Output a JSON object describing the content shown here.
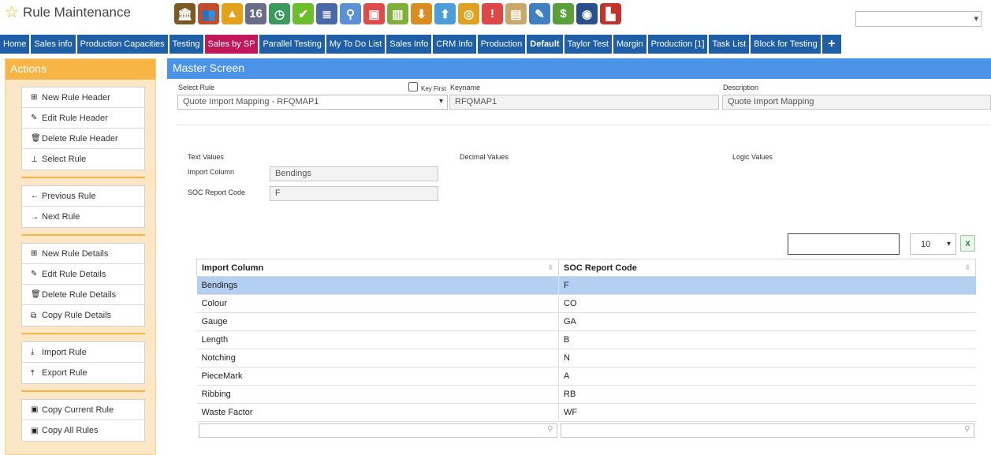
{
  "app": {
    "title": "Rule Maintenance"
  },
  "toolbar_icons": [
    {
      "name": "bank-icon",
      "glyph": "🏛",
      "color": "#7a5a1e"
    },
    {
      "name": "users-icon",
      "glyph": "👥",
      "color": "#c44b2b"
    },
    {
      "name": "landscape-icon",
      "glyph": "▲",
      "color": "#e6a11b"
    },
    {
      "name": "calendar-icon",
      "glyph": "16",
      "color": "#6b6b8a"
    },
    {
      "name": "clock-icon",
      "glyph": "◷",
      "color": "#3a9b5c"
    },
    {
      "name": "checkmark-icon",
      "glyph": "✔",
      "color": "#6cbf2a"
    },
    {
      "name": "list-icon",
      "glyph": "≣",
      "color": "#4a69a8"
    },
    {
      "name": "magnifier-icon",
      "glyph": "⚲",
      "color": "#5b8fd6"
    },
    {
      "name": "presentation-icon",
      "glyph": "▣",
      "color": "#e14a4a"
    },
    {
      "name": "basket-icon",
      "glyph": "▥",
      "color": "#7fb03a"
    },
    {
      "name": "download-icon",
      "glyph": "⬇",
      "color": "#d98c1f"
    },
    {
      "name": "upload-icon",
      "glyph": "⬆",
      "color": "#4a9fd9"
    },
    {
      "name": "coins-icon",
      "glyph": "◎",
      "color": "#e0a020"
    },
    {
      "name": "chat-icon",
      "glyph": "!",
      "color": "#e04848"
    },
    {
      "name": "clipboard-icon",
      "glyph": "▤",
      "color": "#c9a86a"
    },
    {
      "name": "pencil-icon",
      "glyph": "✎",
      "color": "#3f7fc2"
    },
    {
      "name": "money-icon",
      "glyph": "$",
      "color": "#5a9f3a"
    },
    {
      "name": "globe-icon",
      "glyph": "◉",
      "color": "#2a4f8f"
    },
    {
      "name": "factory-icon",
      "glyph": "▙",
      "color": "#c4332b"
    }
  ],
  "tabs": [
    {
      "label": "Home",
      "style": ""
    },
    {
      "label": "Sales info",
      "style": ""
    },
    {
      "label": "Production Capacities",
      "style": ""
    },
    {
      "label": "Testing",
      "style": ""
    },
    {
      "label": "Sales by SP",
      "style": "active"
    },
    {
      "label": "Parallel Testing",
      "style": ""
    },
    {
      "label": "My To Do List",
      "style": ""
    },
    {
      "label": "Sales Info",
      "style": ""
    },
    {
      "label": "CRM Info",
      "style": ""
    },
    {
      "label": "Production",
      "style": ""
    },
    {
      "label": "Default",
      "style": "bold"
    },
    {
      "label": "Taylor Test",
      "style": ""
    },
    {
      "label": "Margin",
      "style": ""
    },
    {
      "label": "Production [1]",
      "style": ""
    },
    {
      "label": "Task List",
      "style": ""
    },
    {
      "label": "Block for Testing",
      "style": ""
    }
  ],
  "plus_tab": "+",
  "sidebar": {
    "title": "Actions",
    "groups": [
      [
        {
          "label": "New Rule Header",
          "icon": "plus-square-icon",
          "glyph": "⊞"
        },
        {
          "label": "Edit Rule Header",
          "icon": "pencil-icon",
          "glyph": "✎"
        },
        {
          "label": "Delete Rule Header",
          "icon": "trash-icon",
          "glyph": "🗑"
        },
        {
          "label": "Select Rule",
          "icon": "pin-icon",
          "glyph": "⊥"
        }
      ],
      [
        {
          "label": "Previous Rule",
          "icon": "arrow-left-icon",
          "glyph": "←"
        },
        {
          "label": "Next Rule",
          "icon": "arrow-right-icon",
          "glyph": "→"
        }
      ],
      [
        {
          "label": "New Rule Details",
          "icon": "plus-square-icon",
          "glyph": "⊞"
        },
        {
          "label": "Edit Rule Details",
          "icon": "pencil-icon",
          "glyph": "✎"
        },
        {
          "label": "Delete Rule Details",
          "icon": "trash-icon",
          "glyph": "🗑"
        },
        {
          "label": "Copy Rule Details",
          "icon": "copy-icon",
          "glyph": "⧉"
        }
      ],
      [
        {
          "label": "Import Rule",
          "icon": "import-icon",
          "glyph": "⤓"
        },
        {
          "label": "Export Rule",
          "icon": "export-icon",
          "glyph": "⤒"
        }
      ],
      [
        {
          "label": "Copy Current Rule",
          "icon": "save-icon",
          "glyph": "▣"
        },
        {
          "label": "Copy All Rules",
          "icon": "save-icon",
          "glyph": "▣"
        }
      ]
    ]
  },
  "main": {
    "title": "Master Screen",
    "select_rule_label": "Select Rule",
    "select_rule_value": "Quote Import Mapping - RFQMAP1",
    "key_first_label": "Key First",
    "keyname_label": "Keyname",
    "keyname_value": "RFQMAP1",
    "description_label": "Description",
    "description_value": "Quote Import Mapping",
    "text_values_label": "Text Values",
    "decimal_values_label": "Decimal Values",
    "logic_values_label": "Logic Values",
    "import_column_label": "Import Column",
    "import_column_value": "Bendings",
    "soc_report_code_label": "SOC Report Code",
    "soc_report_code_value": "F"
  },
  "table": {
    "page_length": "10",
    "columns": [
      "Import Column",
      "SOC Report Code"
    ],
    "rows": [
      [
        "Bendings",
        "F"
      ],
      [
        "Colour",
        "CO"
      ],
      [
        "Gauge",
        "GA"
      ],
      [
        "Length",
        "B"
      ],
      [
        "Notching",
        "N"
      ],
      [
        "PieceMark",
        "A"
      ],
      [
        "Ribbing",
        "RB"
      ],
      [
        "Waste Factor",
        "WF"
      ]
    ],
    "selected_row": 0
  }
}
